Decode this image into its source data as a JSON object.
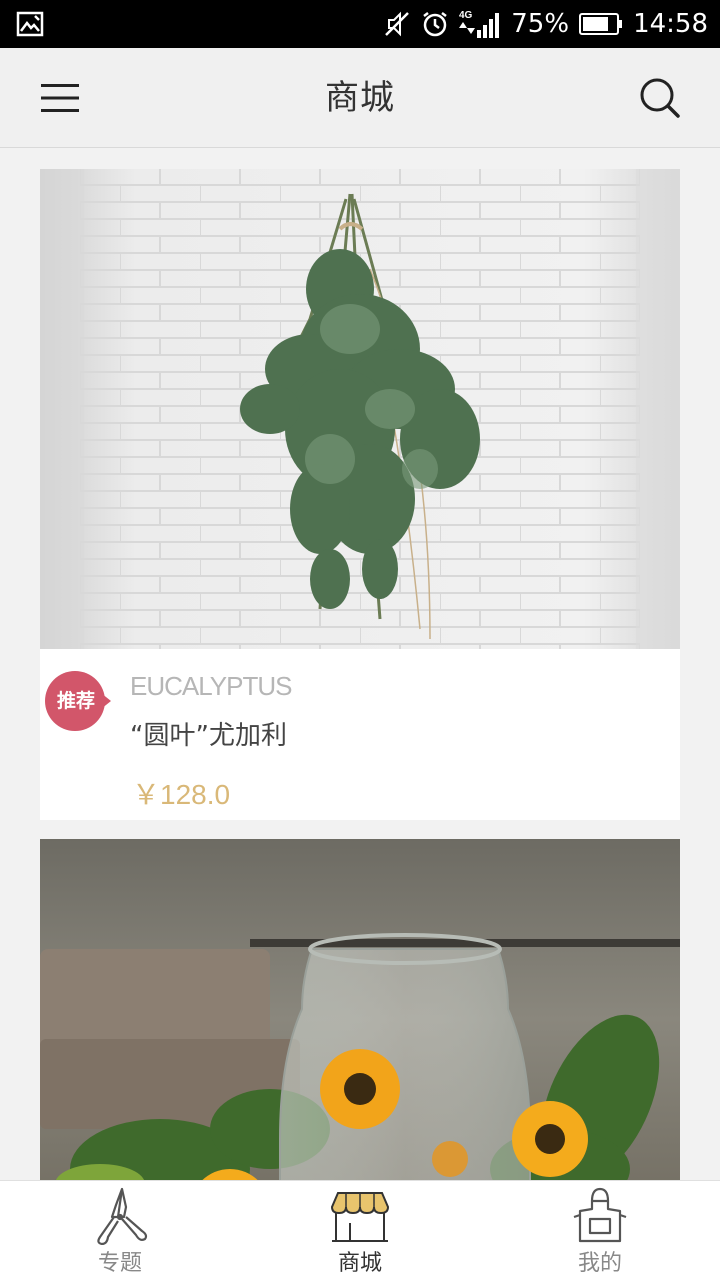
{
  "status_bar": {
    "battery": "75%",
    "time": "14:58",
    "network": "4G"
  },
  "header": {
    "title": "商城",
    "menu_icon": "hamburger-menu-icon",
    "search_icon": "search-icon"
  },
  "products": [
    {
      "image_desc_icon": "eucalyptus-bundle-photo",
      "badge": "推荐",
      "name_en": "EUCALYPTUS",
      "name_cn": "“圆叶”尤加利",
      "price": "￥128.0"
    },
    {
      "image_desc_icon": "glass-vase-sunflowers-photo"
    }
  ],
  "bottom_nav": [
    {
      "label": "专题",
      "icon": "pruning-shears-icon",
      "active": false
    },
    {
      "label": "商城",
      "icon": "shop-awning-icon",
      "active": true
    },
    {
      "label": "我的",
      "icon": "apron-icon",
      "active": false
    }
  ],
  "colors": {
    "badge": "#d2566a",
    "price": "#d9b878",
    "awning": "#e8c46d"
  }
}
